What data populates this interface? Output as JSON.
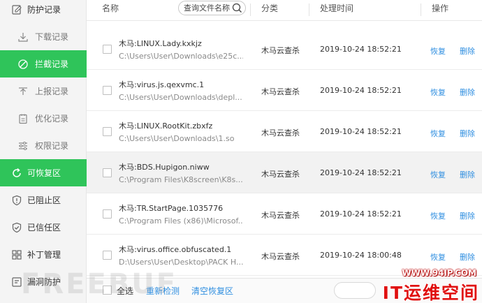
{
  "sidebar": {
    "items": [
      {
        "label": "防护记录",
        "icon": "shield-record-icon",
        "kind": "top"
      },
      {
        "label": "下载记录",
        "icon": "download-icon",
        "kind": "sub"
      },
      {
        "label": "拦截记录",
        "icon": "block-icon",
        "kind": "sub"
      },
      {
        "label": "上报记录",
        "icon": "upload-icon",
        "kind": "sub"
      },
      {
        "label": "优化记录",
        "icon": "optimize-icon",
        "kind": "sub"
      },
      {
        "label": "权限记录",
        "icon": "permission-icon",
        "kind": "sub"
      },
      {
        "label": "可恢复区",
        "icon": "restore-icon",
        "kind": "top"
      },
      {
        "label": "已阻止区",
        "icon": "blocked-shield-icon",
        "kind": "top"
      },
      {
        "label": "已信任区",
        "icon": "trusted-shield-icon",
        "kind": "top"
      },
      {
        "label": "补丁管理",
        "icon": "patch-icon",
        "kind": "top"
      },
      {
        "label": "漏洞防护",
        "icon": "vuln-icon",
        "kind": "top"
      }
    ]
  },
  "header": {
    "col_name": "名称",
    "search_placeholder": "查询文件名称",
    "col_category": "分类",
    "col_time": "处理时间",
    "col_action": "操作"
  },
  "rows": [
    {
      "name": "木马:LINUX.Lady.kxkjz",
      "path": "C:\\Users\\User\\Downloads\\e25c...",
      "category": "木马云查杀",
      "time": "2019-10-24 18:52:21",
      "restore": "恢复",
      "delete": "删除"
    },
    {
      "name": "木马:virus.js.qexvmc.1",
      "path": "C:\\Users\\User\\Downloads\\depl...",
      "category": "木马云查杀",
      "time": "2019-10-24 18:52:21",
      "restore": "恢复",
      "delete": "删除"
    },
    {
      "name": "木马:LINUX.RootKit.zbxfz",
      "path": "C:\\Users\\User\\Downloads\\1.so",
      "category": "木马云查杀",
      "time": "2019-10-24 18:52:21",
      "restore": "恢复",
      "delete": "删除"
    },
    {
      "name": "木马:BDS.Hupigon.niww",
      "path": "C:\\Program Files\\K8screen\\K8s...",
      "category": "木马云查杀",
      "time": "2019-10-24 18:52:21",
      "restore": "恢复",
      "delete": "删除"
    },
    {
      "name": "木马:TR.StartPage.1035776",
      "path": "C:\\Program Files (x86)\\Microsof...",
      "category": "木马云查杀",
      "time": "2019-10-24 18:52:21",
      "restore": "恢复",
      "delete": "删除"
    },
    {
      "name": "木马:virus.office.obfuscated.1",
      "path": "D:\\Users\\User\\Desktop\\PACK H...",
      "category": "木马云查杀",
      "time": "2019-10-24 18:00:48",
      "restore": "恢复",
      "delete": "删除"
    }
  ],
  "footer": {
    "select_all": "全选",
    "rescan": "重新检测",
    "clear": "清空恢复区"
  },
  "watermarks": {
    "freebuf": "FREEBUF",
    "site_url": "WWW.94IP.COM",
    "site_brand": "IT运维空间"
  },
  "colors": {
    "accent": "#2fc45a",
    "link": "#2e8ee0",
    "watermark_red": "#e01010"
  }
}
